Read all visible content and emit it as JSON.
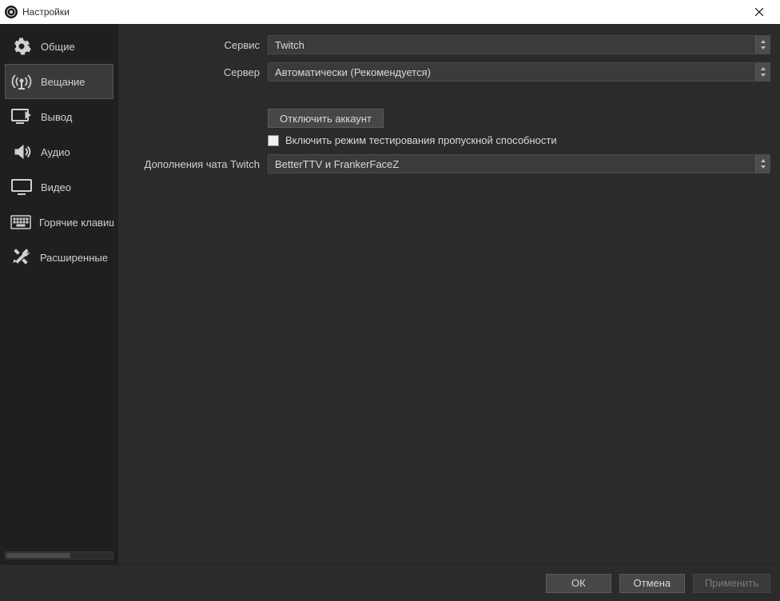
{
  "window": {
    "title": "Настройки"
  },
  "sidebar": {
    "items": [
      {
        "id": "general",
        "label": "Общие"
      },
      {
        "id": "stream",
        "label": "Вещание"
      },
      {
        "id": "output",
        "label": "Вывод"
      },
      {
        "id": "audio",
        "label": "Аудио"
      },
      {
        "id": "video",
        "label": "Видео"
      },
      {
        "id": "hotkeys",
        "label": "Горячие клавиши"
      },
      {
        "id": "advanced",
        "label": "Расширенные"
      }
    ],
    "active": "stream"
  },
  "form": {
    "service_label": "Сервис",
    "service_value": "Twitch",
    "server_label": "Сервер",
    "server_value": "Автоматически (Рекомендуется)",
    "disconnect_label": "Отключить аккаунт",
    "bandwidth_test_label": "Включить режим тестирования пропускной способности",
    "bandwidth_test_checked": false,
    "addons_label": "Дополнения чата Twitch",
    "addons_value": "BetterTTV и FrankerFaceZ"
  },
  "footer": {
    "ok": "ОК",
    "cancel": "Отмена",
    "apply": "Применить"
  }
}
